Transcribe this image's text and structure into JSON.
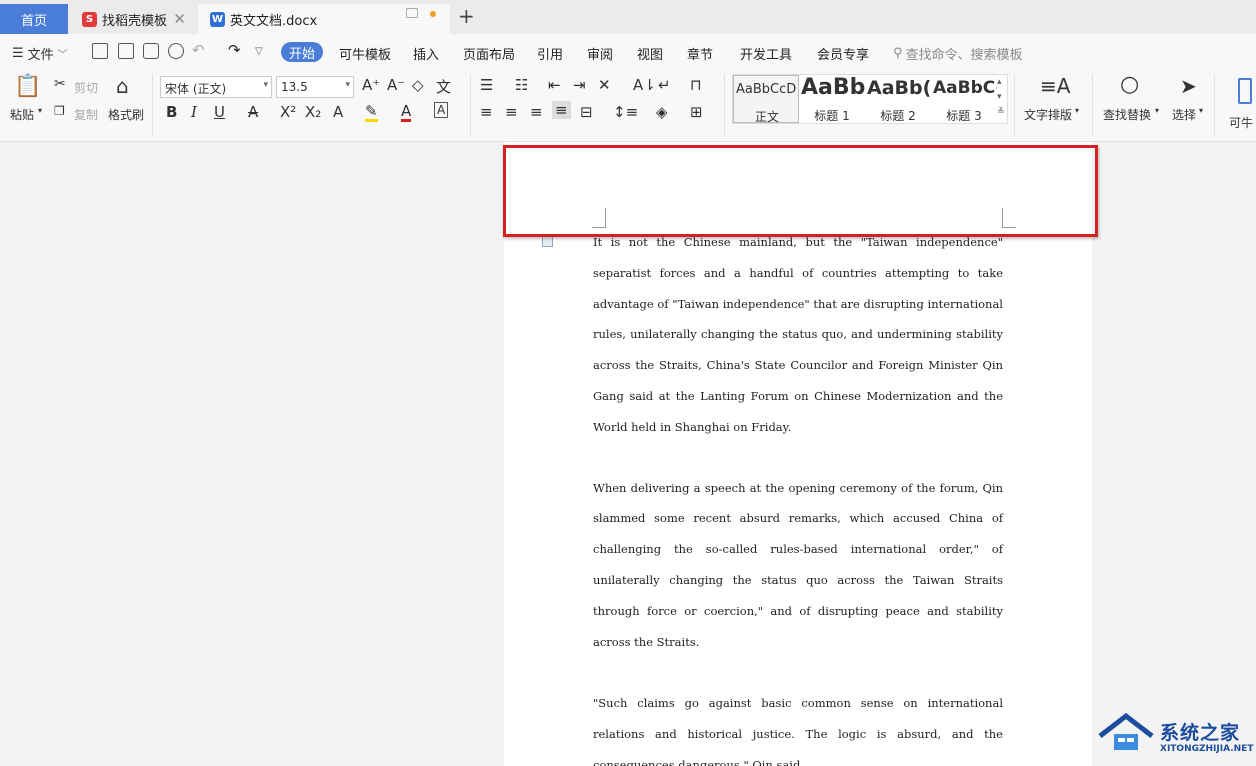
{
  "tabs": {
    "home": "首页",
    "template": "找稻壳模板",
    "document": "英文文档.docx",
    "template_icon_letter": "S",
    "document_icon_letter": "W"
  },
  "menu": {
    "file": "文件",
    "active": "开始",
    "items": [
      "可牛模板",
      "插入",
      "页面布局",
      "引用",
      "审阅",
      "视图",
      "章节",
      "开发工具",
      "会员专享"
    ],
    "search_placeholder": "查找命令、搜索模板"
  },
  "ribbon": {
    "paste": "粘贴",
    "cut": "剪切",
    "copy": "复制",
    "format_painter": "格式刷",
    "font_name": "宋体 (正文)",
    "font_size": "13.5",
    "styles": [
      {
        "sample": "AaBbCcD",
        "name": "正文"
      },
      {
        "sample": "AaBb",
        "name": "标题 1"
      },
      {
        "sample": "AaBb(",
        "name": "标题 2"
      },
      {
        "sample": "AaBbC(",
        "name": "标题 3"
      }
    ],
    "text_layout": "文字排版",
    "find_replace": "查找替换",
    "select": "选择",
    "extra": "可牛"
  },
  "document": {
    "paragraphs": [
      "It is not the Chinese mainland, but the \"Taiwan independence\" separatist forces and a handful of countries attempting to take advantage of \"Taiwan independence\" that are disrupting international rules, unilaterally changing the status quo, and undermining stability across the Straits, China's State Councilor and Foreign Minister Qin Gang said at the Lanting Forum on Chinese Modernization and the World held in Shanghai on Friday.",
      "When delivering a speech at the opening ceremony of the forum, Qin slammed some recent absurd remarks, which accused China of challenging the so-called rules-based international order,\" of unilaterally changing the status quo across the Taiwan Straits through force or coercion,\" and of disrupting peace and stability across the Straits.",
      "\"Such claims go against basic common sense on international relations and historical justice. The logic is absurd, and the consequences dangerous,\" Qin said."
    ]
  },
  "watermark": {
    "name": "系统之家",
    "url": "XITONGZHIJIA.NET"
  },
  "colors": {
    "accent": "#4a7dd8",
    "highlight": "#d42020",
    "watermark": "#1c4c9c"
  }
}
